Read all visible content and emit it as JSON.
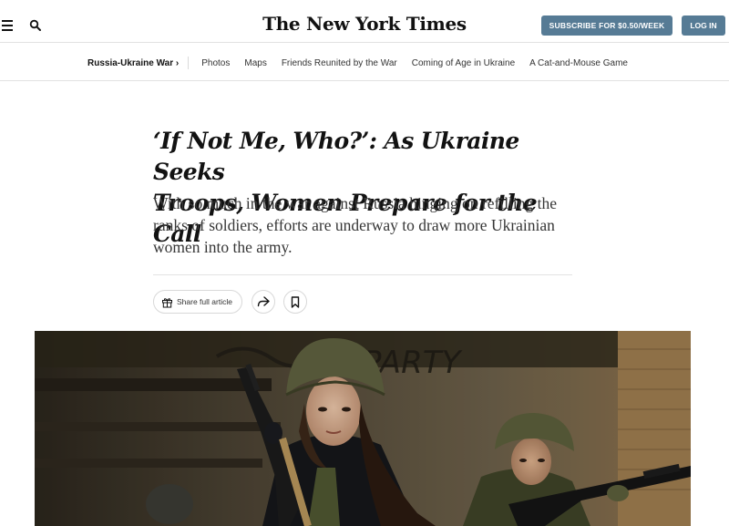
{
  "header": {
    "masthead": "The New York Times",
    "subscribe_label": "SUBSCRIBE FOR $0.50/WEEK",
    "login_label": "LOG IN",
    "icons": [
      "menu-icon",
      "search-icon"
    ]
  },
  "subnav": {
    "section": "Russia-Ukraine War ›",
    "links": [
      "Photos",
      "Maps",
      "Friends Reunited by the War",
      "Coming of Age in Ukraine",
      "A Cat-and-Mouse Game"
    ]
  },
  "article": {
    "headline_line1": "‘If Not Me, Who?’: As Ukraine Seeks",
    "headline_line2": "Troops, Women Prepare for the Call",
    "summary": "With so much in the war against Russia hinging on refilling the ranks of soldiers, efforts are underway to draw more Ukrainian women into the army.",
    "share_full_label": "Share full article",
    "icons": [
      "gift-icon",
      "share-arrow-icon",
      "bookmark-icon"
    ]
  },
  "photo": {
    "wall_graffiti": "PARTY"
  },
  "colors": {
    "button_blue": "#567b95",
    "text": "#121212",
    "divider": "#e2e2e2"
  }
}
